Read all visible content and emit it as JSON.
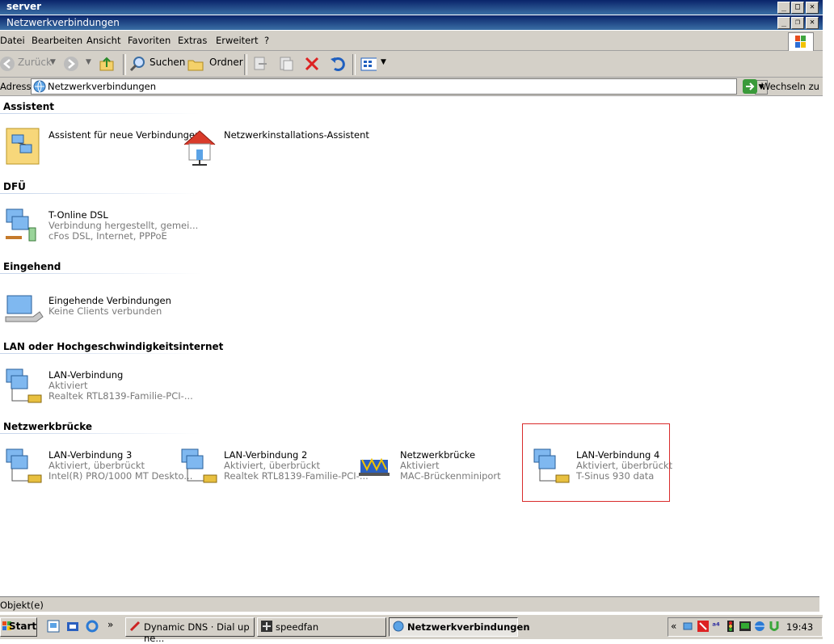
{
  "outer_window": {
    "title": "server"
  },
  "inner_window": {
    "title": "Netzwerkverbindungen"
  },
  "menu": [
    {
      "label": "Datei"
    },
    {
      "label": "Bearbeiten"
    },
    {
      "label": "Ansicht"
    },
    {
      "label": "Favoriten"
    },
    {
      "label": "Extras"
    },
    {
      "label": "Erweitert"
    },
    {
      "label": "?"
    }
  ],
  "toolbar": {
    "back_label": "Zurück",
    "search_label": "Suchen",
    "folders_label": "Ordner"
  },
  "address": {
    "label": "Adresse",
    "value": "Netzwerkverbindungen",
    "go_label": "Wechseln zu"
  },
  "groups": {
    "assistant": {
      "title": "Assistent",
      "items": [
        {
          "name": "Assistent für neue Verbindungen"
        },
        {
          "name": "Netzwerkinstallations-Assistent"
        }
      ]
    },
    "dfu": {
      "title": "DFÜ",
      "items": [
        {
          "name": "T-Online DSL",
          "line1": "Verbindung hergestellt, gemei...",
          "line2": "cFos DSL, Internet, PPPoE"
        }
      ]
    },
    "incoming": {
      "title": "Eingehend",
      "items": [
        {
          "name": "Eingehende Verbindungen",
          "line1": "Keine Clients verbunden"
        }
      ]
    },
    "lan": {
      "title": "LAN oder Hochgeschwindigkeitsinternet",
      "items": [
        {
          "name": "LAN-Verbindung",
          "line1": "Aktiviert",
          "line2": "Realtek RTL8139-Familie-PCI-..."
        }
      ]
    },
    "bridge": {
      "title": "Netzwerkbrücke",
      "items": [
        {
          "name": "LAN-Verbindung 3",
          "line1": "Aktiviert, überbrückt",
          "line2": "Intel(R) PRO/1000 MT Deskto..."
        },
        {
          "name": "LAN-Verbindung 2",
          "line1": "Aktiviert, überbrückt",
          "line2": "Realtek RTL8139-Familie-PCI-..."
        },
        {
          "name": "Netzwerkbrücke",
          "line1": "Aktiviert",
          "line2": "MAC-Brückenminiport"
        },
        {
          "name": "LAN-Verbindung 4",
          "line1": "Aktiviert, überbrückt",
          "line2": "T-Sinus 930 data"
        }
      ]
    }
  },
  "status": {
    "text": "Objekt(e)"
  },
  "taskbar": {
    "start_label": "Start",
    "tasks": [
      {
        "label": "Dynamic DNS · Dial up ne..."
      },
      {
        "label": "speedfan"
      },
      {
        "label": "Netzwerkverbindungen"
      }
    ],
    "clock": "19:43"
  }
}
